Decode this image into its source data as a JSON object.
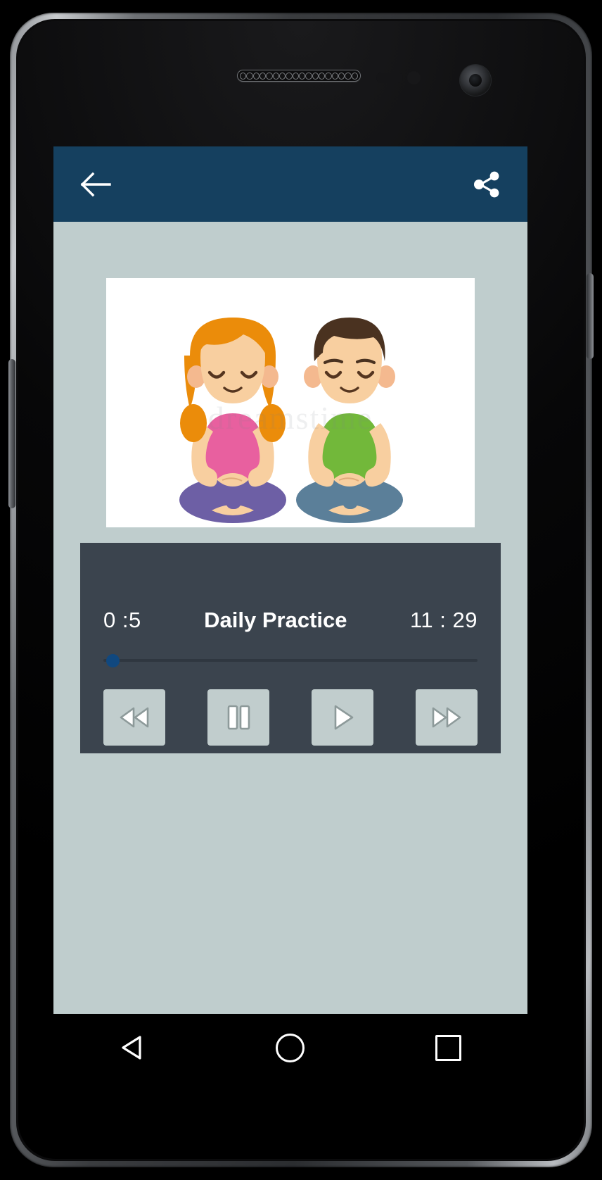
{
  "device": {
    "type": "android-phone",
    "hardware": {
      "earpiece": "earpiece-speaker",
      "front_camera": "front-camera",
      "proximity_sensor": "proximity-sensor",
      "light_sensor": "ambient-light-sensor",
      "volume_key": "volume-rocker",
      "power_key": "power-button"
    }
  },
  "appbar": {
    "background": "#15405f",
    "back_icon": "arrow-left-icon",
    "share_icon": "share-icon"
  },
  "screen": {
    "background": "#bfcdcd"
  },
  "artwork": {
    "name": "meditating-children-illustration",
    "watermark": "dreamstime",
    "background": "#ffffff",
    "girl": {
      "hair": "#eb8c0a",
      "shirt": "#e8609f",
      "pants": "#6d5fa5",
      "skin": "#f8cfa0"
    },
    "boy": {
      "hair": "#4a3220",
      "shirt": "#72b83a",
      "pants": "#5b7f99",
      "skin": "#f8cfa0"
    }
  },
  "player": {
    "background": "#3b444e",
    "title": "Daily Practice",
    "elapsed": "0 :5",
    "duration": "11 : 29",
    "progress_percent": 1,
    "seek": {
      "track_color": "#2f3740",
      "thumb_color": "#10487f"
    },
    "controls": [
      {
        "name": "rewind-button",
        "icon": "rewind-icon",
        "label": "Rewind"
      },
      {
        "name": "pause-button",
        "icon": "pause-icon",
        "label": "Pause"
      },
      {
        "name": "play-button",
        "icon": "play-icon",
        "label": "Play"
      },
      {
        "name": "fast-forward-button",
        "icon": "fast-forward-icon",
        "label": "Fast forward"
      }
    ],
    "button_color": "#c1cdcd"
  },
  "navbar": {
    "background": "#000000",
    "items": [
      {
        "name": "nav-back-button",
        "icon": "triangle-back-icon",
        "label": "Back"
      },
      {
        "name": "nav-home-button",
        "icon": "circle-home-icon",
        "label": "Home"
      },
      {
        "name": "nav-recents-button",
        "icon": "square-recents-icon",
        "label": "Recent apps"
      }
    ]
  }
}
